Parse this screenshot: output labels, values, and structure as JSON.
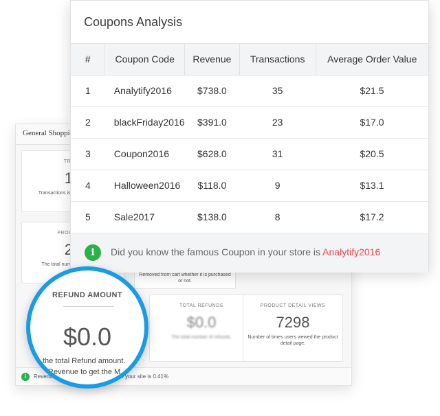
{
  "back_panel": {
    "title": "General Shoppin",
    "cards": [
      {
        "label": "TRANS",
        "value": "10",
        "desc": "Transactions is t completed purc"
      },
      {
        "label": "PRODUCT A",
        "value": "28",
        "desc": "The total numbe cart whether"
      },
      {
        "label": "",
        "value": "",
        "desc": "Removed from cart whether it is purchased or not."
      },
      {
        "label": "TOTAL REFUNDS",
        "value": "$0.0",
        "desc": "The total number of refunds."
      },
      {
        "label": "PRODUCT DETAIL VIEWS",
        "value": "7298",
        "desc": "Number of times users viewed the product detail page."
      }
    ],
    "footer_text": "Revenue to get the M ersion Rate on your site is 0.41%"
  },
  "coupons": {
    "title": "Coupons Analysis",
    "columns": [
      "#",
      "Coupon Code",
      "Revenue",
      "Transactions",
      "Average Order Value"
    ],
    "rows": [
      {
        "num": "1",
        "code": "Analytify2016",
        "revenue": "$738.0",
        "transactions": "35",
        "aov": "$21.5"
      },
      {
        "num": "2",
        "code": "blackFriday2016",
        "revenue": "$391.0",
        "transactions": "23",
        "aov": "$17.0"
      },
      {
        "num": "3",
        "code": "Coupon2016",
        "revenue": "$628.0",
        "transactions": "31",
        "aov": "$20.5"
      },
      {
        "num": "4",
        "code": "Halloween2016",
        "revenue": "$118.0",
        "transactions": "9",
        "aov": "$13.1"
      },
      {
        "num": "5",
        "code": "Sale2017",
        "revenue": "$138.0",
        "transactions": "8",
        "aov": "$17.2"
      }
    ],
    "tip_text": "Did you know the famous Coupon in your store is ",
    "tip_highlight": "Analytify2016",
    "tip_icon": "info-icon",
    "highlight_color": "#e8474a"
  },
  "magnifier": {
    "label": "REFUND AMOUNT",
    "value": "$0.0",
    "desc": "the total Refund amount.",
    "extra": "Revenue to get the M"
  },
  "colors": {
    "accent_ring": "#1a9be6",
    "info_green": "#2bb04a"
  }
}
